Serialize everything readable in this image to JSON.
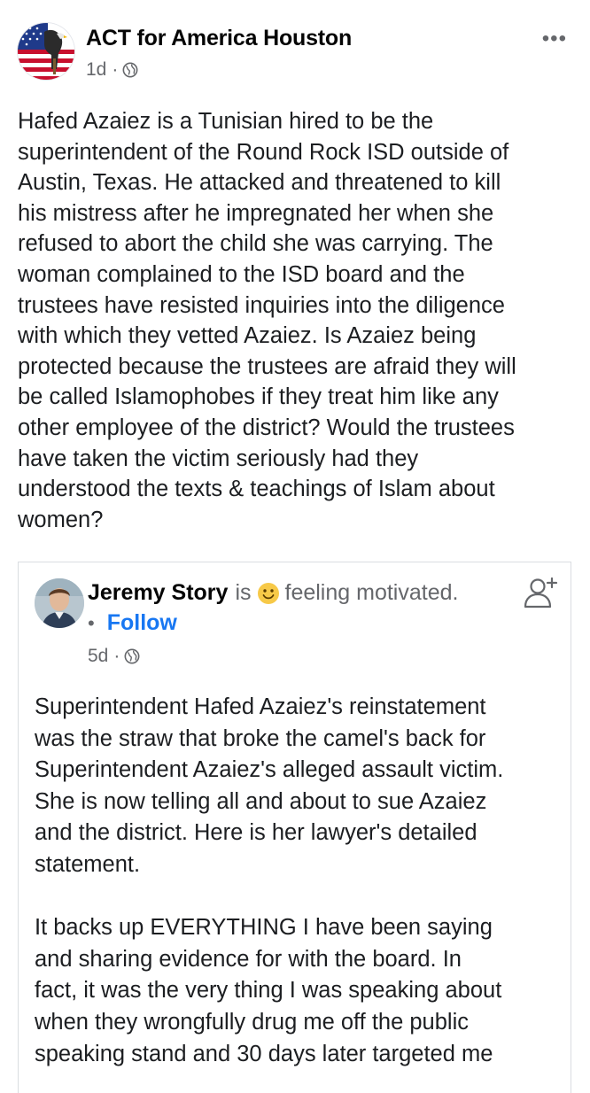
{
  "post": {
    "page_name": "ACT for America Houston",
    "time": "1d",
    "separator": "·",
    "more_label": "•••",
    "body": "Hafed Azaiez is a Tunisian hired to be the\nsuperintendent of the Round Rock ISD outside of\nAustin, Texas. He attacked and threatened to kill\nhis mistress after he impregnated her when she\nrefused to abort the child she was carrying. The\nwoman complained to the ISD board and the\ntrustees have resisted inquiries into the diligence\nwith which they vetted Azaiez. Is Azaiez being\nprotected because the trustees are afraid they will\nbe called Islamophobes if they treat him like any\nother employee of the district? Would the trustees\nhave taken the victim seriously had they\nunderstood the texts & teachings of Islam about\nwomen?"
  },
  "shared": {
    "author": "Jeremy Story",
    "is_word": "is",
    "feeling": "feeling motivated.",
    "bullet": "•",
    "follow_label": "Follow",
    "time": "5d",
    "separator": "·",
    "body": "Superintendent Hafed Azaiez's reinstatement\nwas the straw that broke the camel's back for\nSuperintendent Azaiez's alleged assault victim.\nShe is now telling all and about to sue Azaiez\nand the district.  Here is her lawyer's detailed\nstatement.\n\nIt backs up EVERYTHING I have been saying\nand sharing evidence for with the board.  In\nfact, it was the very thing I was speaking about\nwhen they wrongfully drug me off the public\nspeaking stand and 30 days later targeted me"
  },
  "icons": {
    "page_avatar": "flag-eagle-avatar",
    "globe": "globe-icon",
    "more": "more-options-icon",
    "shared_avatar": "profile-photo-avatar",
    "emoji": "smiling-face-emoji",
    "add_friend": "add-friend-icon"
  },
  "colors": {
    "link": "#1877f2",
    "secondary_text": "#65676b",
    "primary_text": "#1c1e21",
    "card_border": "#dadde1"
  }
}
